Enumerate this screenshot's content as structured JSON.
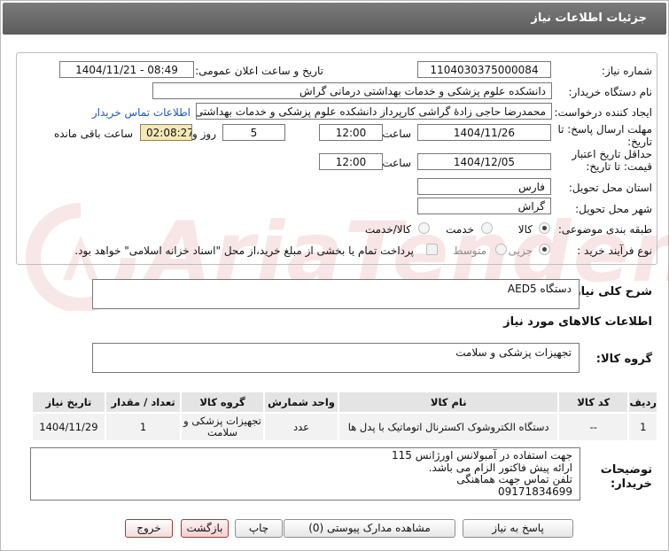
{
  "window": {
    "title": "جزئیات اطلاعات نیاز"
  },
  "watermark": "AriaTender.net",
  "fields": {
    "need_number_label": "شماره نیاز:",
    "need_number": "1104030375000084",
    "announce_label": "تاریخ و ساعت اعلان عمومی:",
    "announce_value": "1404/11/21 - 08:49",
    "buyer_label": "نام دستگاه خریدار:",
    "buyer_value": "دانشکده علوم پزشکی و خدمات بهداشتی  درمانی گراش",
    "creator_label": "ایجاد کننده درخواست:",
    "creator_value": "محمدرضا  حاجی زادۀ گراشی کارپرداز دانشکده علوم پزشکی و خدمات بهداشتی",
    "contact_link": "اطلاعات تماس خریدار",
    "deadline_label_1": "مهلت ارسال پاسخ: تا",
    "deadline_label_2": "تاریخ:",
    "deadline_date": "1404/11/26",
    "time_label": "ساعت",
    "deadline_time": "12:00",
    "days_value": "5",
    "days_label": "روز و",
    "remaining_time": "02:08:27",
    "remaining_label": "ساعت باقی مانده",
    "validity_label_1": "حداقل تاریخ اعتبار",
    "validity_label_2": "قیمت: تا تاریخ:",
    "validity_date": "1404/12/05",
    "validity_time": "12:00",
    "province_label": "استان محل تحویل:",
    "province_value": "فارس",
    "city_label": "شهر محل تحویل:",
    "city_value": "گراش",
    "category_label": "طبقه بندی موضوعی:",
    "category_options": [
      "کالا",
      "خدمت",
      "کالا/خدمت"
    ],
    "category_selected": "کالا",
    "process_label": "نوع فرآیند خرید :",
    "process_options": [
      "جزیی",
      "متوسط"
    ],
    "process_selected": "جزیی",
    "payment_note": "پرداخت تمام یا بخشی از مبلغ خرید،از محل \"اسناد خزانه اسلامی\" خواهد بود."
  },
  "summary": {
    "general_desc_label": "شرح کلی نیاز:",
    "general_desc_value": "دستگاه AED5",
    "goods_info_heading": "اطلاعات کالاهای مورد نیاز",
    "goods_group_label": "گروه کالا:",
    "goods_group_value": "تجهیزات پزشکی و سلامت"
  },
  "table": {
    "headers": [
      "ردیف",
      "کد کالا",
      "نام کالا",
      "واحد شمارش",
      "گروه کالا",
      "تعداد / مقدار",
      "تاریخ نیاز"
    ],
    "rows": [
      {
        "row": "1",
        "code": "--",
        "name": "دستگاه الکتروشوک اکسترنال اتوماتیک با پدل ها",
        "unit": "عدد",
        "group": "تجهیزات پزشکی و سلامت",
        "qty": "1",
        "date": "1404/11/29"
      }
    ]
  },
  "buyer_notes": {
    "label_1": "توضیحات",
    "label_2": "خریدار:",
    "lines": [
      "جهت استفاده در آمبولانس اورژانس 115",
      "ارائه پیش فاکتور الزام می باشد.",
      "تلفن تماس جهت هماهنگی",
      "09171834699"
    ]
  },
  "buttons": {
    "reply": "پاسخ به نیاز",
    "view_docs": "مشاهده مدارک پیوستی (0)",
    "print": "چاپ",
    "back": "بازگشت",
    "exit": "خروج"
  }
}
